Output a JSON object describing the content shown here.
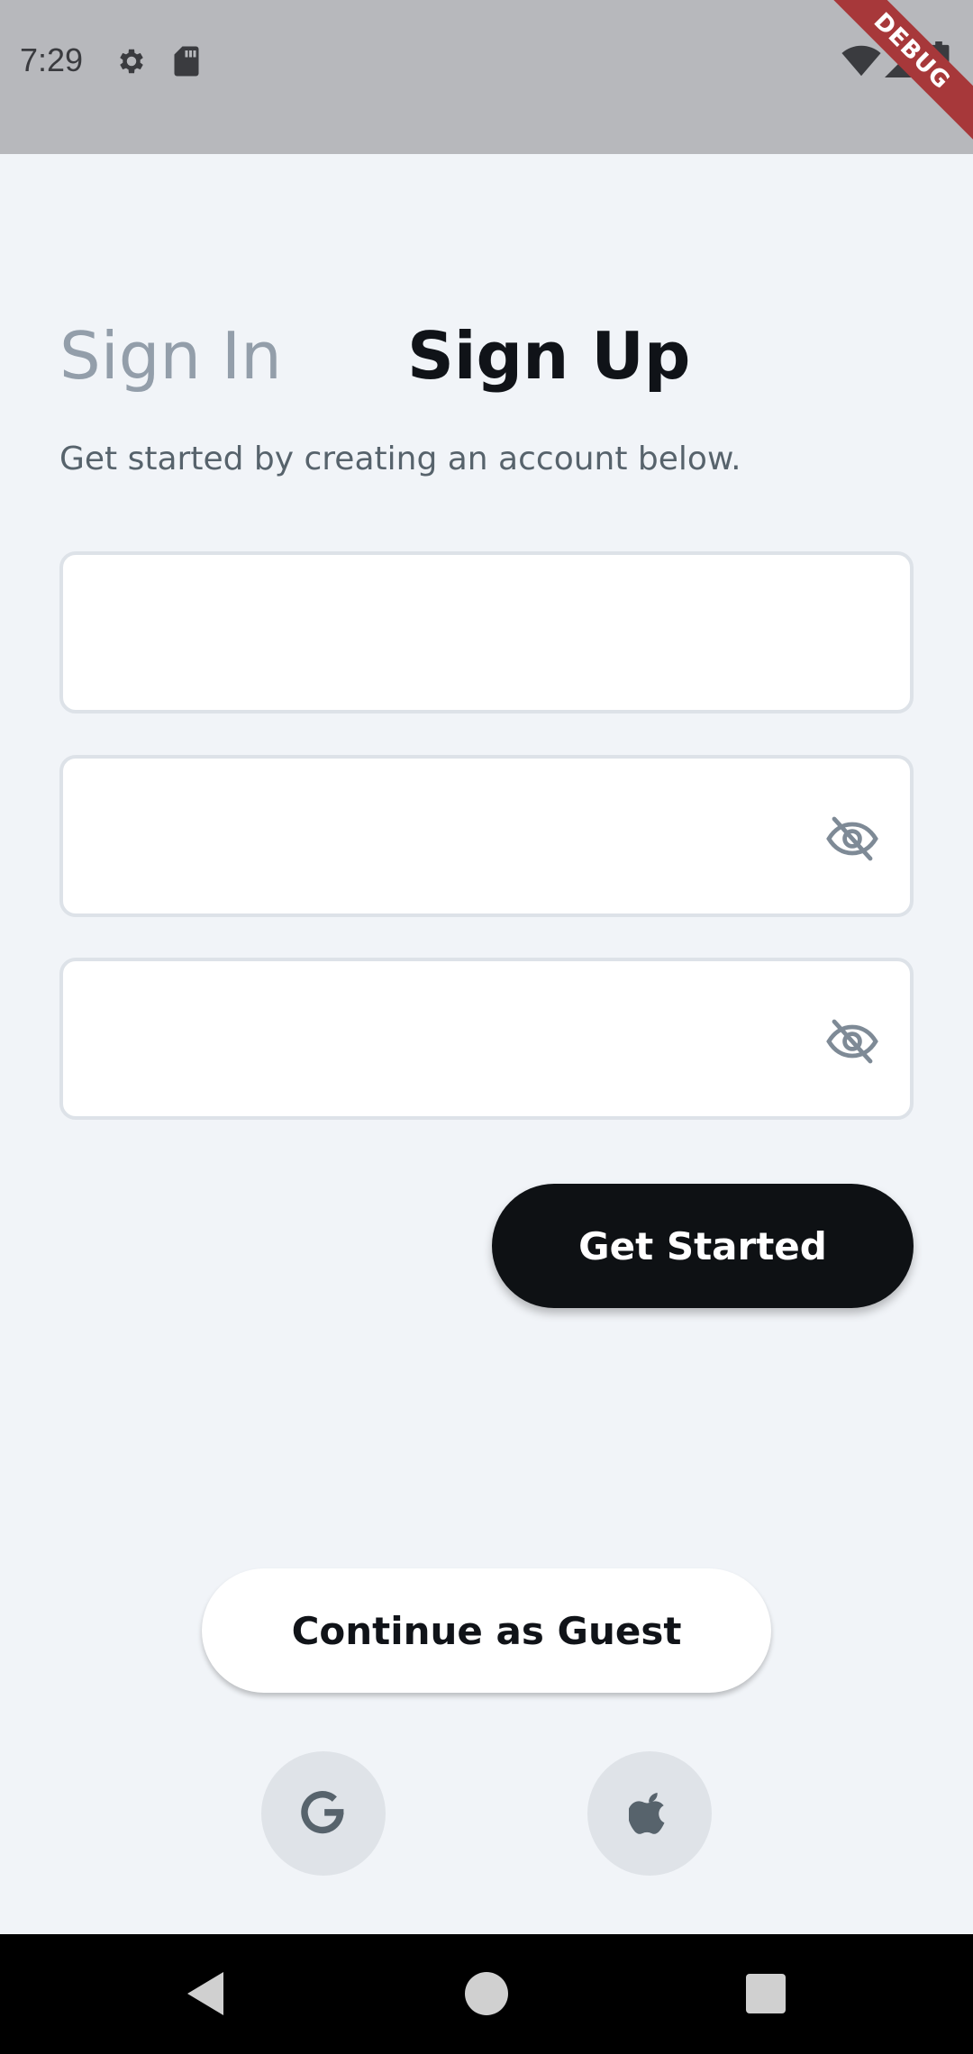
{
  "status_bar": {
    "time": "7:29",
    "icons": [
      "gear-icon",
      "sd-card-icon",
      "wifi-icon",
      "signal-icon",
      "battery-icon"
    ],
    "debug_label": "DEBUG"
  },
  "auth": {
    "tabs": {
      "sign_in": "Sign In",
      "sign_up": "Sign Up",
      "active": "sign_up"
    },
    "subtitle": "Get started by creating an account below.",
    "fields": {
      "email_value": "",
      "password_value": "",
      "confirm_password_value": ""
    },
    "primary_button": "Get Started",
    "guest_button": "Continue as Guest",
    "social": [
      "google-icon",
      "apple-icon"
    ]
  },
  "colors": {
    "background": "#F1F4F8",
    "primary": "#0E1114",
    "inactive_tab": "#939EAA",
    "debug": "#A7383A"
  }
}
